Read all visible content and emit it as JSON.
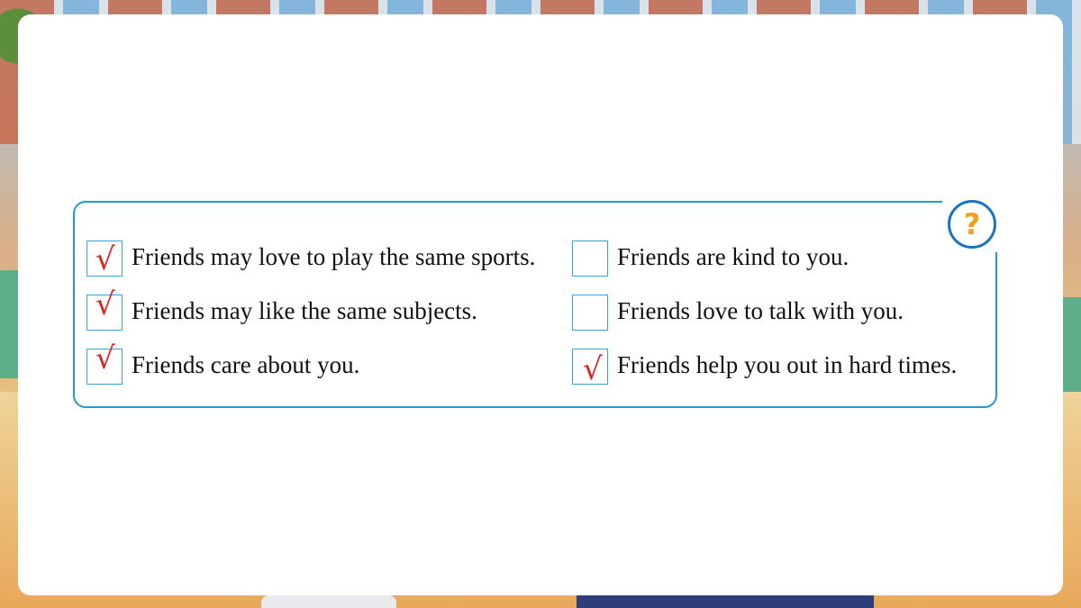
{
  "help_badge": {
    "symbol": "?",
    "icon": "question-mark-icon",
    "color": "#f2a019",
    "ring_color": "#1a73c2"
  },
  "checklist": {
    "border_color": "#1f9ad6",
    "check_symbol": "√",
    "check_color": "#e02020",
    "left": [
      {
        "text": "Friends may love to play the same sports.",
        "checked": true
      },
      {
        "text": "Friends may like the same subjects.",
        "checked": true
      },
      {
        "text": "Friends care about you.",
        "checked": true
      }
    ],
    "right": [
      {
        "text": "Friends are kind to you.",
        "checked": false
      },
      {
        "text": "Friends love to talk with you.",
        "checked": false
      },
      {
        "text": "Friends help you out in hard times.",
        "checked": true
      }
    ]
  }
}
